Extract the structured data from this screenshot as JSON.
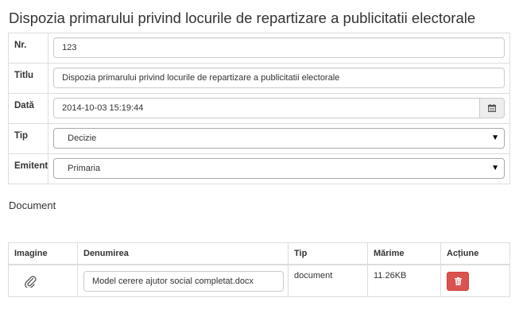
{
  "page": {
    "title": "Dispozia primarului privind locurile de repartizare a publicitatii electorale"
  },
  "form": {
    "nr": {
      "label": "Nr.",
      "value": "123"
    },
    "titlu": {
      "label": "Titlu",
      "value": "Dispozia primarului privind locurile de repartizare a publicitatii electorale"
    },
    "data": {
      "label": "Dată",
      "value": "2014-10-03 15:19:44",
      "icon": "calendar-icon"
    },
    "tip": {
      "label": "Tip",
      "selected": "Decizie",
      "icon": "caret-down-icon"
    },
    "emitent": {
      "label": "Emitent",
      "selected": "Primaria",
      "icon": "caret-down-icon"
    }
  },
  "documents": {
    "section_label": "Document",
    "columns": [
      "Imagine",
      "Denumirea",
      "Tip",
      "Mărime",
      "Acțiune"
    ],
    "rows": [
      {
        "image_icon": "paperclip-icon",
        "name": "Model cerere ajutor social completat.docx",
        "type": "document",
        "size": "11.26KB",
        "action_icon": "trash-icon"
      }
    ]
  },
  "colors": {
    "danger": "#d9534f",
    "border": "#dddddd",
    "text": "#333333"
  }
}
